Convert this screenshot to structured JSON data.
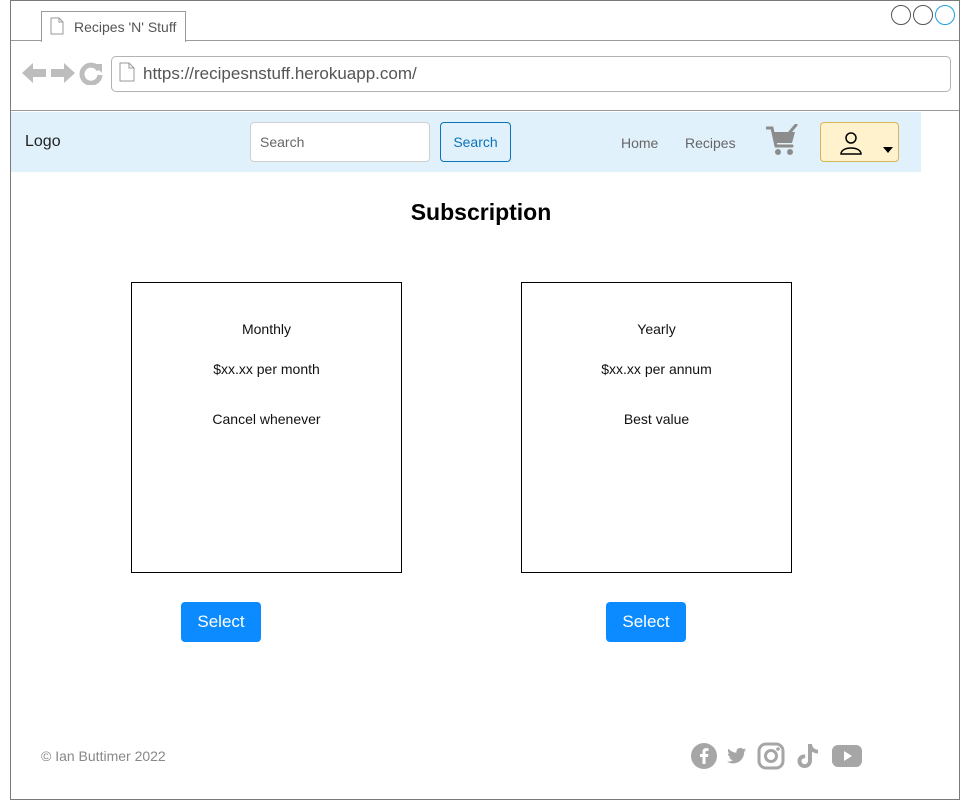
{
  "browser": {
    "tab_title": "Recipes 'N' Stuff",
    "url": "https://recipesnstuff.herokuapp.com/"
  },
  "header": {
    "logo": "Logo",
    "search_placeholder": "Search",
    "search_button": "Search",
    "nav": [
      "Home",
      "Recipes"
    ],
    "icons": [
      "cart-icon",
      "user-icon",
      "caret-down-icon"
    ]
  },
  "main": {
    "title": "Subscription",
    "plans": [
      {
        "name": "Monthly",
        "price": "$xx.xx per month",
        "note": "Cancel whenever",
        "button": "Select"
      },
      {
        "name": "Yearly",
        "price": "$xx.xx per annum",
        "note": "Best value",
        "button": "Select"
      }
    ]
  },
  "footer": {
    "copyright": "© Ian Buttimer 2022",
    "socials": [
      "facebook-icon",
      "twitter-icon",
      "instagram-icon",
      "tiktok-icon",
      "youtube-icon"
    ]
  },
  "colors": {
    "header_bg": "#e1f1fb",
    "accent": "#0b73b8",
    "primary_button": "#0b8bff",
    "user_menu_bg": "#fff2cc",
    "icon_gray": "#a6a6a6"
  }
}
